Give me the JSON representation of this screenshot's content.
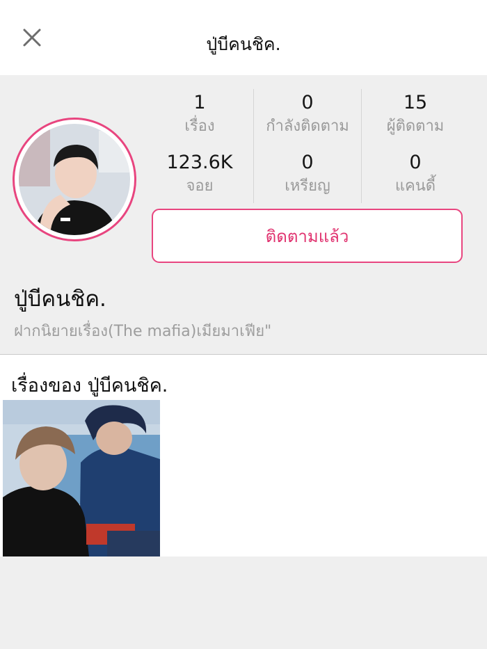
{
  "header": {
    "title": "ปู่บีคนชิค."
  },
  "profile": {
    "stats": [
      {
        "value": "1",
        "label": "เรื่อง"
      },
      {
        "value": "0",
        "label": "กำลังติดตาม"
      },
      {
        "value": "15",
        "label": "ผู้ติดตาม"
      },
      {
        "value": "123.6K",
        "label": "จอย"
      },
      {
        "value": "0",
        "label": "เหรียญ"
      },
      {
        "value": "0",
        "label": "แคนดี้"
      }
    ],
    "follow_button_label": "ติดตามแล้ว",
    "name": "ปู่บีคนชิค.",
    "bio": "ฝากนิยายเรื่อง(The mafia)เมียมาเฟีย\""
  },
  "stories": {
    "title": "เรื่องของ ปู่บีคนชิค."
  },
  "colors": {
    "accent": "#e8457f",
    "page_background": "#efefef",
    "secondary_text": "#9a9a9a"
  },
  "icons": {
    "close": "close-icon"
  }
}
